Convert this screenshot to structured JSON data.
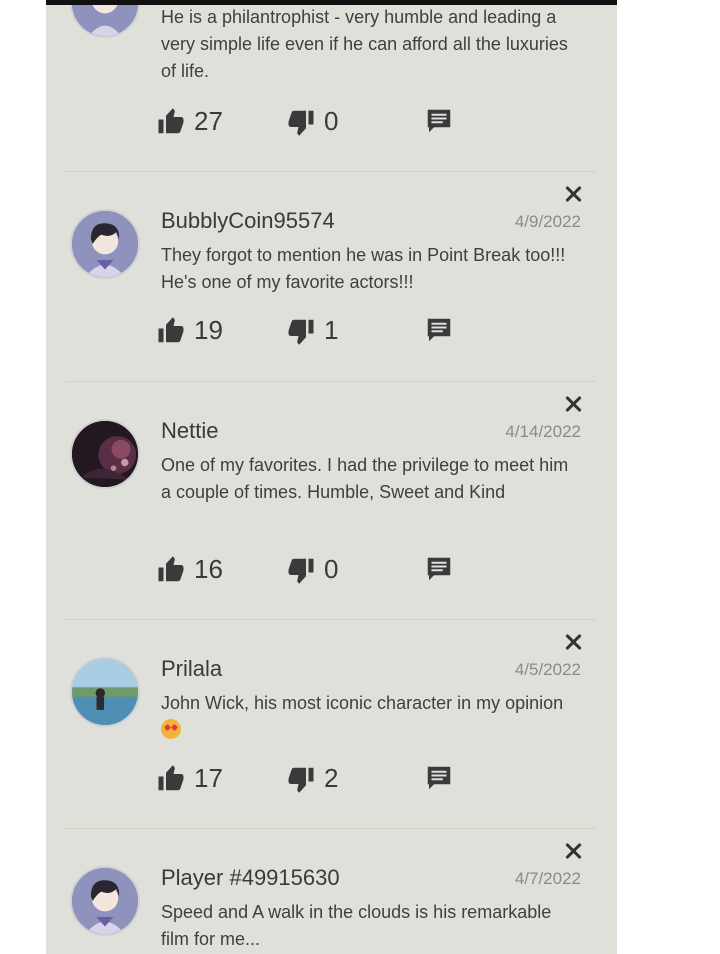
{
  "colors": {
    "panel_bg": "#dfe0da",
    "text": "#3f3f3f",
    "muted": "#8a8a8a",
    "divider": "#c7d6c3"
  },
  "comments": [
    {
      "username": "",
      "date": "",
      "text": "He is a philantrophist - very humble and leading a very simple life even if he can afford all the luxuries of life.",
      "likes": "27",
      "dislikes": "0",
      "avatar_icon": "default-avatar-icon"
    },
    {
      "username": "BubblyCoin95574",
      "date": "4/9/2022",
      "text": "They forgot to mention he was in Point Break too!!! He's one of my favorite actors!!!",
      "likes": "19",
      "dislikes": "1",
      "avatar_icon": "default-avatar-icon"
    },
    {
      "username": "Nettie",
      "date": "4/14/2022",
      "text": "One of my favorites. I had the privilege to meet him a couple of times.  Humble,  Sweet and Kind",
      "likes": "16",
      "dislikes": "0",
      "avatar_icon": "photo-avatar-icon"
    },
    {
      "username": "Prilala",
      "date": "4/5/2022",
      "text": "John Wick, his most iconic character in my opinion",
      "likes": "17",
      "dislikes": "2",
      "avatar_icon": "beach-photo-avatar-icon"
    },
    {
      "username": "Player #49915630",
      "date": "4/7/2022",
      "text": "Speed and A walk in the clouds is his remarkable film for me...",
      "likes": "",
      "dislikes": "",
      "avatar_icon": "default-avatar-icon"
    }
  ]
}
